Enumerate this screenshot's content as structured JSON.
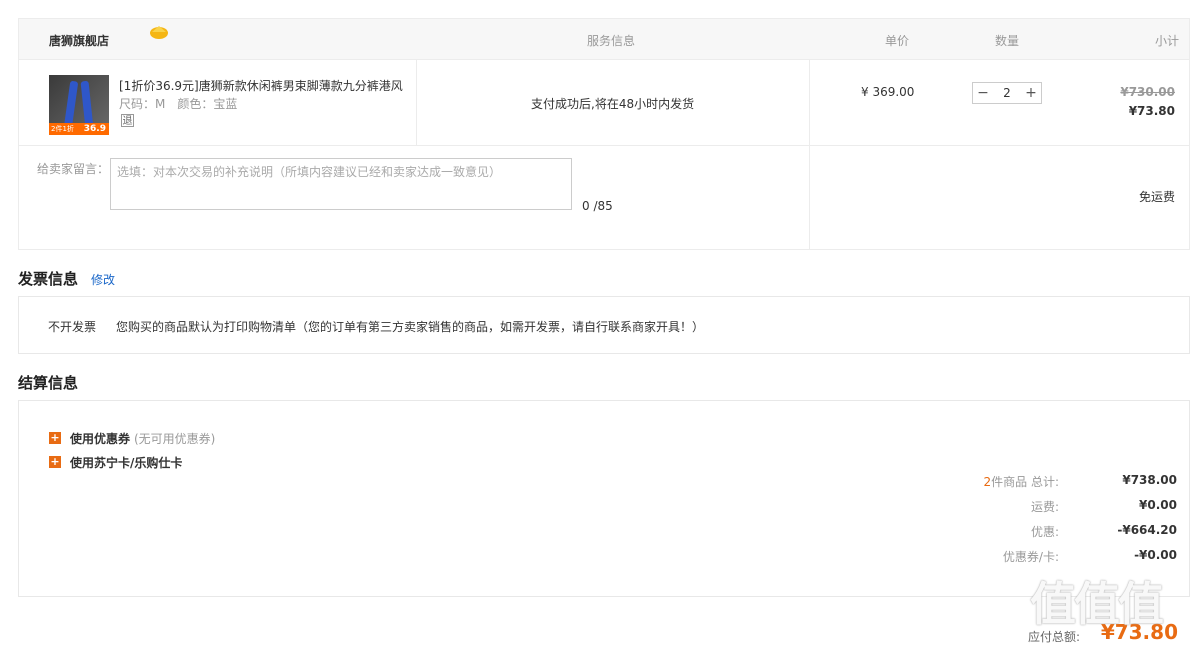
{
  "header": {
    "store_name": "唐狮旗舰店",
    "col_service": "服务信息",
    "col_price": "单价",
    "col_qty": "数量",
    "col_subtotal": "小计"
  },
  "item": {
    "title": "[1折价36.9元]唐狮新款休闲裤男束脚薄款九分裤港风",
    "spec": "尺码：M　颜色：宝蓝",
    "refund_badge": "退",
    "thumb_tag_left": "2件1折",
    "thumb_tag_right": "36.9",
    "service_text": "支付成功后,将在48小时内发货",
    "unit_price": "¥ 369.00",
    "qty_minus": "−",
    "qty_value": "2",
    "qty_plus": "+",
    "orig_subtotal": "¥730.00",
    "subtotal": "¥73.80"
  },
  "message": {
    "label": "给卖家留言：",
    "placeholder": "选填：对本次交易的补充说明（所填内容建议已经和卖家达成一致意见）",
    "count": "0 /85",
    "shipping": "免运费"
  },
  "invoice": {
    "title": "发票信息",
    "edit": "修改",
    "type": "不开发票",
    "note": "您购买的商品默认为打印购物清单（您的订单有第三方卖家销售的商品，如需开发票，请自行联系商家开具！）"
  },
  "settlement": {
    "title": "结算信息",
    "coupon_label": "使用优惠券",
    "coupon_note": "(无可用优惠券)",
    "card_label": "使用苏宁卡/乐购仕卡",
    "item_count": "2",
    "item_count_suffix": "件商品 总计:",
    "total": "¥738.00",
    "shipping_label": "运费:",
    "shipping_value": "¥0.00",
    "discount_label": "优惠:",
    "discount_value": "-¥664.20",
    "coupon_card_label": "优惠券/卡:",
    "coupon_card_value": "-¥0.00",
    "due_label": "应付总额:",
    "due_value": "¥73.80"
  },
  "watermark": "值值值",
  "colors": {
    "accent": "#e86b13",
    "link": "#1a67c9"
  }
}
